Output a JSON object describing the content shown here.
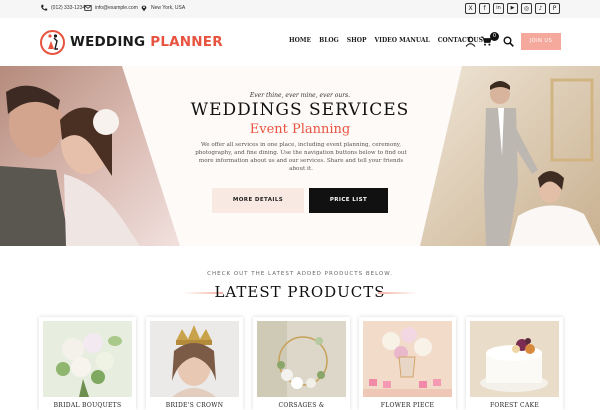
{
  "topbar": {
    "phone": "(012) 333-1234",
    "email": "info@example.com",
    "location": "New York, USA",
    "social": [
      "X",
      "f",
      "in",
      "▶",
      "◎",
      "♪",
      "P"
    ]
  },
  "header": {
    "logo_main": "WEDDING",
    "logo_accent": "PLANNER",
    "nav": [
      "HOME",
      "BLOG",
      "SHOP",
      "VIDEO MANUAL",
      "CONTACT US"
    ],
    "cart_count": "0",
    "join_label": "JOIN US"
  },
  "hero": {
    "tagline": "Ever thine, ever mine, ever ours.",
    "title": "WEDDINGS SERVICES",
    "subtitle": "Event Planning",
    "description": "We offer all services in one place, including event planning, ceremony, photography, and fine dining. Use the navigation buttons below to find out more information about us and our services. Share and tell your friends about it.",
    "btn_more": "MORE DETAILS",
    "btn_price": "PRICE LIST"
  },
  "latest": {
    "kicker": "CHECK OUT THE LATEST ADDED PRODUCTS BELOW.",
    "title": "LATEST PRODUCTS",
    "products": [
      {
        "name": "BRIDAL BOUQUETS"
      },
      {
        "name": "BRIDE'S CROWN"
      },
      {
        "name": "CORSAGES &"
      },
      {
        "name": "FLOWER PIECE"
      },
      {
        "name": "FOREST CAKE"
      }
    ]
  },
  "colors": {
    "accent": "#e8533f",
    "join_bg": "#f5a99c",
    "more_bg": "#f9e9e3",
    "dark": "#111111"
  }
}
